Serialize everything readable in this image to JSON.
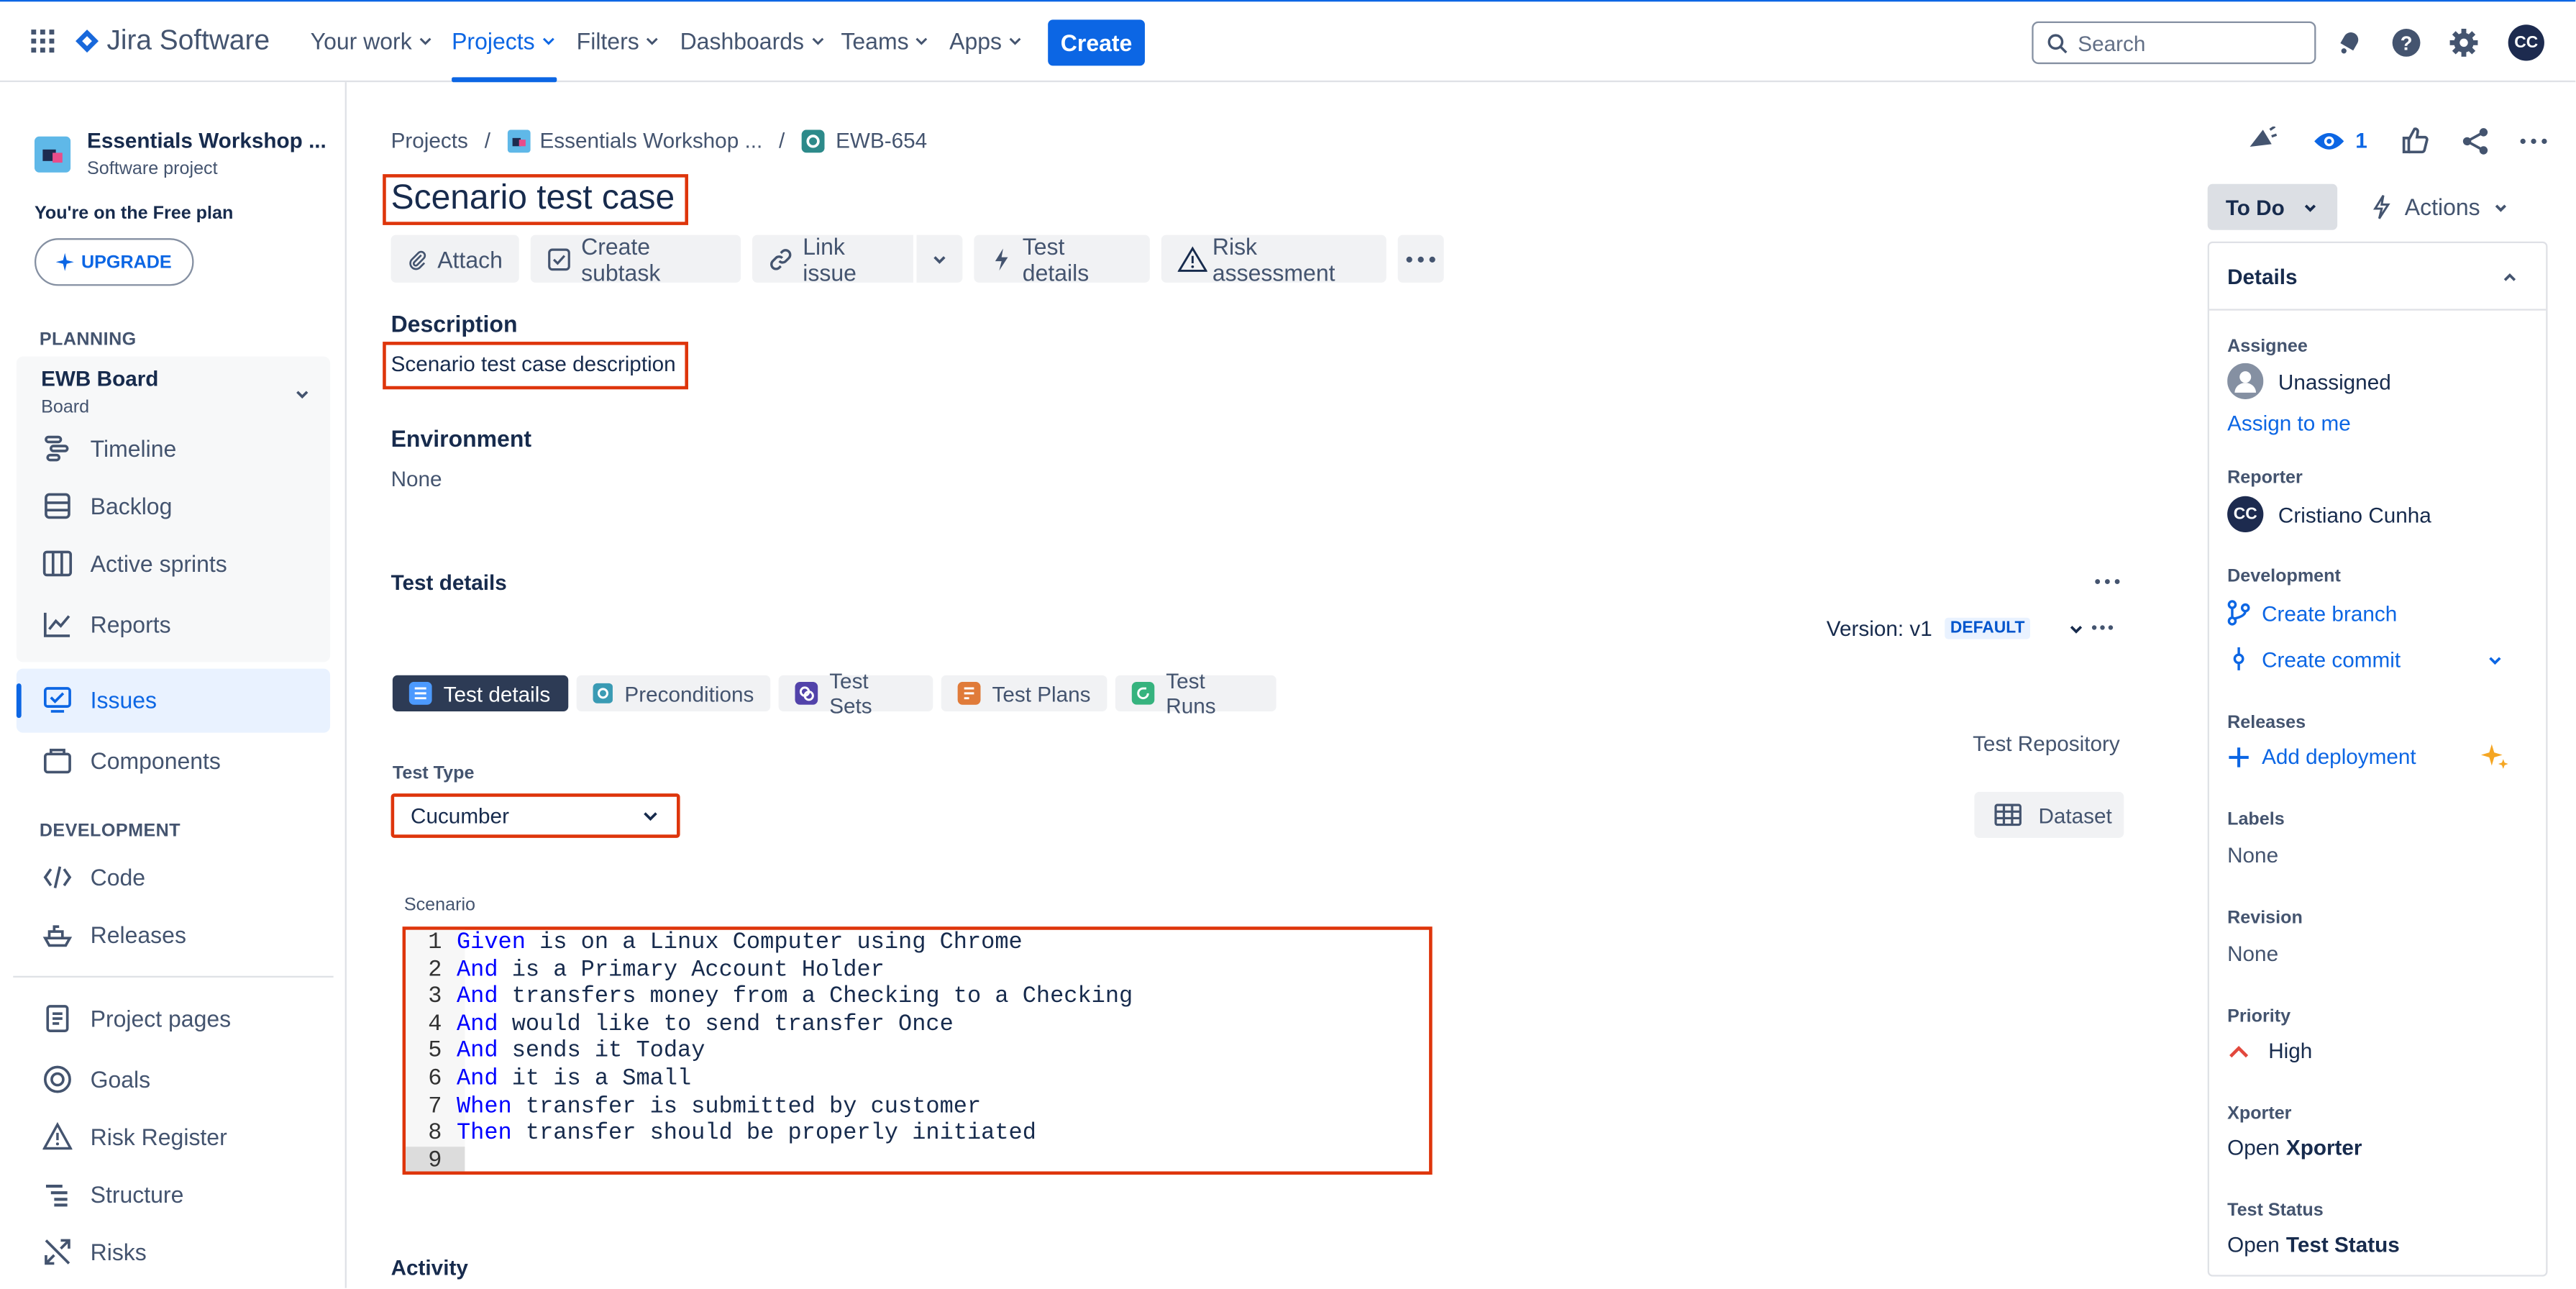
{
  "app": {
    "name": "Jira Software"
  },
  "topnav": {
    "items": [
      {
        "label": "Your work"
      },
      {
        "label": "Projects"
      },
      {
        "label": "Filters"
      },
      {
        "label": "Dashboards"
      },
      {
        "label": "Teams"
      },
      {
        "label": "Apps"
      }
    ],
    "create_label": "Create",
    "search_placeholder": "Search",
    "user_initials": "CC"
  },
  "sidebar": {
    "project_name": "Essentials Workshop ...",
    "project_type": "Software project",
    "plan_text": "You're on the Free plan",
    "upgrade_label": "UPGRADE",
    "planning_heading": "PLANNING",
    "board_name": "EWB Board",
    "board_type": "Board",
    "planning_items": [
      {
        "label": "Timeline"
      },
      {
        "label": "Backlog"
      },
      {
        "label": "Active sprints"
      },
      {
        "label": "Reports"
      }
    ],
    "issues_label": "Issues",
    "components_label": "Components",
    "development_heading": "DEVELOPMENT",
    "development_items": [
      {
        "label": "Code"
      },
      {
        "label": "Releases"
      }
    ],
    "other_items": [
      {
        "label": "Project pages"
      },
      {
        "label": "Goals"
      },
      {
        "label": "Risk Register"
      },
      {
        "label": "Structure"
      },
      {
        "label": "Risks"
      }
    ]
  },
  "breadcrumb": {
    "projects": "Projects",
    "project": "Essentials Workshop ...",
    "issue_key": "EWB-654",
    "sep": "/"
  },
  "issue": {
    "title": "Scenario test case",
    "toolbar": {
      "attach": "Attach",
      "create_subtask": "Create subtask",
      "link_issue": "Link issue",
      "test_details": "Test details",
      "risk_assessment": "Risk assessment"
    },
    "description_heading": "Description",
    "description": "Scenario test case description",
    "environment_heading": "Environment",
    "environment": "None",
    "test_details_heading": "Test details",
    "version_label": "Version: v1",
    "version_badge": "DEFAULT",
    "tabs": [
      {
        "label": "Test details"
      },
      {
        "label": "Preconditions"
      },
      {
        "label": "Test Sets"
      },
      {
        "label": "Test Plans"
      },
      {
        "label": "Test Runs"
      }
    ],
    "test_repository": "Test Repository",
    "test_type_label": "Test Type",
    "test_type_value": "Cucumber",
    "dataset_label": "Dataset",
    "scenario_label": "Scenario",
    "scenario_lines": [
      {
        "num": "1",
        "kw": "Given",
        "text": " is on a Linux Computer using Chrome"
      },
      {
        "num": "2",
        "kw": "And",
        "text": " is a Primary Account Holder"
      },
      {
        "num": "3",
        "kw": "And",
        "text": " transfers money from a Checking to a Checking"
      },
      {
        "num": "4",
        "kw": "And",
        "text": " would like to send transfer Once"
      },
      {
        "num": "5",
        "kw": "And",
        "text": " sends it Today"
      },
      {
        "num": "6",
        "kw": "And",
        "text": " it is a Small"
      },
      {
        "num": "7",
        "kw": "When",
        "text": " transfer is submitted by customer"
      },
      {
        "num": "8",
        "kw": "Then",
        "text": " transfer should be properly initiated"
      },
      {
        "num": "9",
        "kw": "",
        "text": ""
      }
    ],
    "activity_heading": "Activity"
  },
  "header_actions": {
    "watchers": "1"
  },
  "status": {
    "label": "To Do",
    "actions_label": "Actions"
  },
  "details": {
    "heading": "Details",
    "assignee_label": "Assignee",
    "assignee": "Unassigned",
    "assign_to_me": "Assign to me",
    "reporter_label": "Reporter",
    "reporter": "Cristiano Cunha",
    "reporter_initials": "CC",
    "development_label": "Development",
    "create_branch": "Create branch",
    "create_commit": "Create commit",
    "releases_label": "Releases",
    "add_deployment": "Add deployment",
    "labels_label": "Labels",
    "labels": "None",
    "revision_label": "Revision",
    "revision": "None",
    "priority_label": "Priority",
    "priority": "High",
    "xporter_label": "Xporter",
    "xporter_open": "Open",
    "xporter_name": "Xporter",
    "test_status_label": "Test Status",
    "test_status_open": "Open",
    "test_status_name": "Test Status"
  },
  "colors": {
    "accent": "#0c66e4",
    "annotation": "#de350b",
    "sidebar_active_bg": "#e9f2ff"
  }
}
